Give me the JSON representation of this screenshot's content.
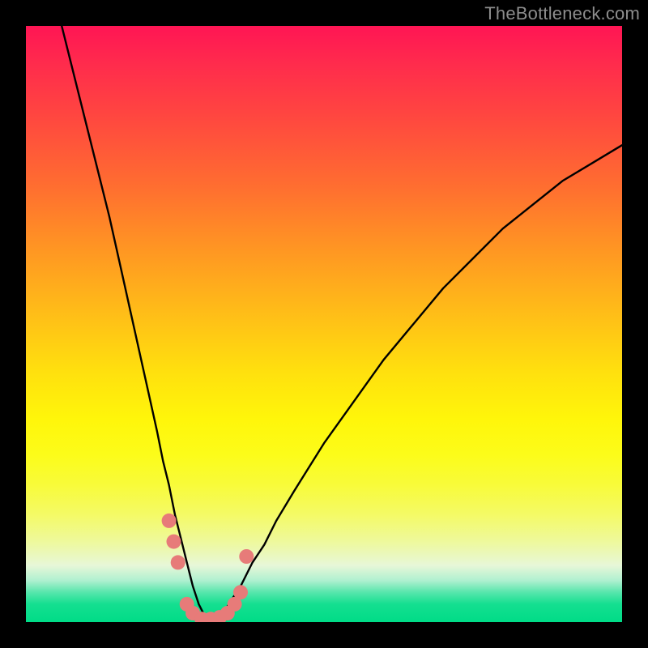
{
  "watermark": "TheBottleneck.com",
  "colors": {
    "background": "#000000",
    "curve": "#000000",
    "dots": "#e77b79",
    "gradient_top": "#ff1554",
    "gradient_bottom": "#00dc87"
  },
  "chart_data": {
    "type": "line",
    "title": "",
    "xlabel": "",
    "ylabel": "",
    "xlim": [
      0,
      100
    ],
    "ylim": [
      0,
      100
    ],
    "grid": false,
    "legend": false,
    "note": "V-shaped bottleneck curve. x is an unlabeled parameter scanned 0–100; y is bottleneck severity (0 = ideal, 100 = worst). Curve minimum near x≈30. Values estimated from pixel positions — no axes/ticks are drawn in the source image.",
    "series": [
      {
        "name": "bottleneck-curve",
        "x": [
          6,
          8,
          10,
          12,
          14,
          16,
          18,
          20,
          22,
          23,
          24,
          25,
          26,
          27,
          28,
          29,
          30,
          31,
          32,
          33,
          34,
          36,
          38,
          40,
          42,
          45,
          50,
          55,
          60,
          65,
          70,
          75,
          80,
          85,
          90,
          95,
          100
        ],
        "y": [
          100,
          92,
          84,
          76,
          68,
          59,
          50,
          41,
          32,
          27,
          23,
          18,
          14,
          10,
          6,
          3,
          1,
          0,
          0,
          1,
          3,
          6,
          10,
          13,
          17,
          22,
          30,
          37,
          44,
          50,
          56,
          61,
          66,
          70,
          74,
          77,
          80
        ]
      }
    ],
    "markers": [
      {
        "name": "highlighted-range-dots",
        "note": "Salmon dots clustered around the curve minimum.",
        "points": [
          {
            "x": 24.0,
            "y": 17.0
          },
          {
            "x": 24.8,
            "y": 13.5
          },
          {
            "x": 25.5,
            "y": 10.0
          },
          {
            "x": 27.0,
            "y": 3.0
          },
          {
            "x": 28.0,
            "y": 1.5
          },
          {
            "x": 29.5,
            "y": 0.5
          },
          {
            "x": 31.0,
            "y": 0.5
          },
          {
            "x": 32.5,
            "y": 0.8
          },
          {
            "x": 33.8,
            "y": 1.5
          },
          {
            "x": 35.0,
            "y": 3.0
          },
          {
            "x": 36.0,
            "y": 5.0
          },
          {
            "x": 37.0,
            "y": 11.0
          }
        ]
      }
    ]
  }
}
